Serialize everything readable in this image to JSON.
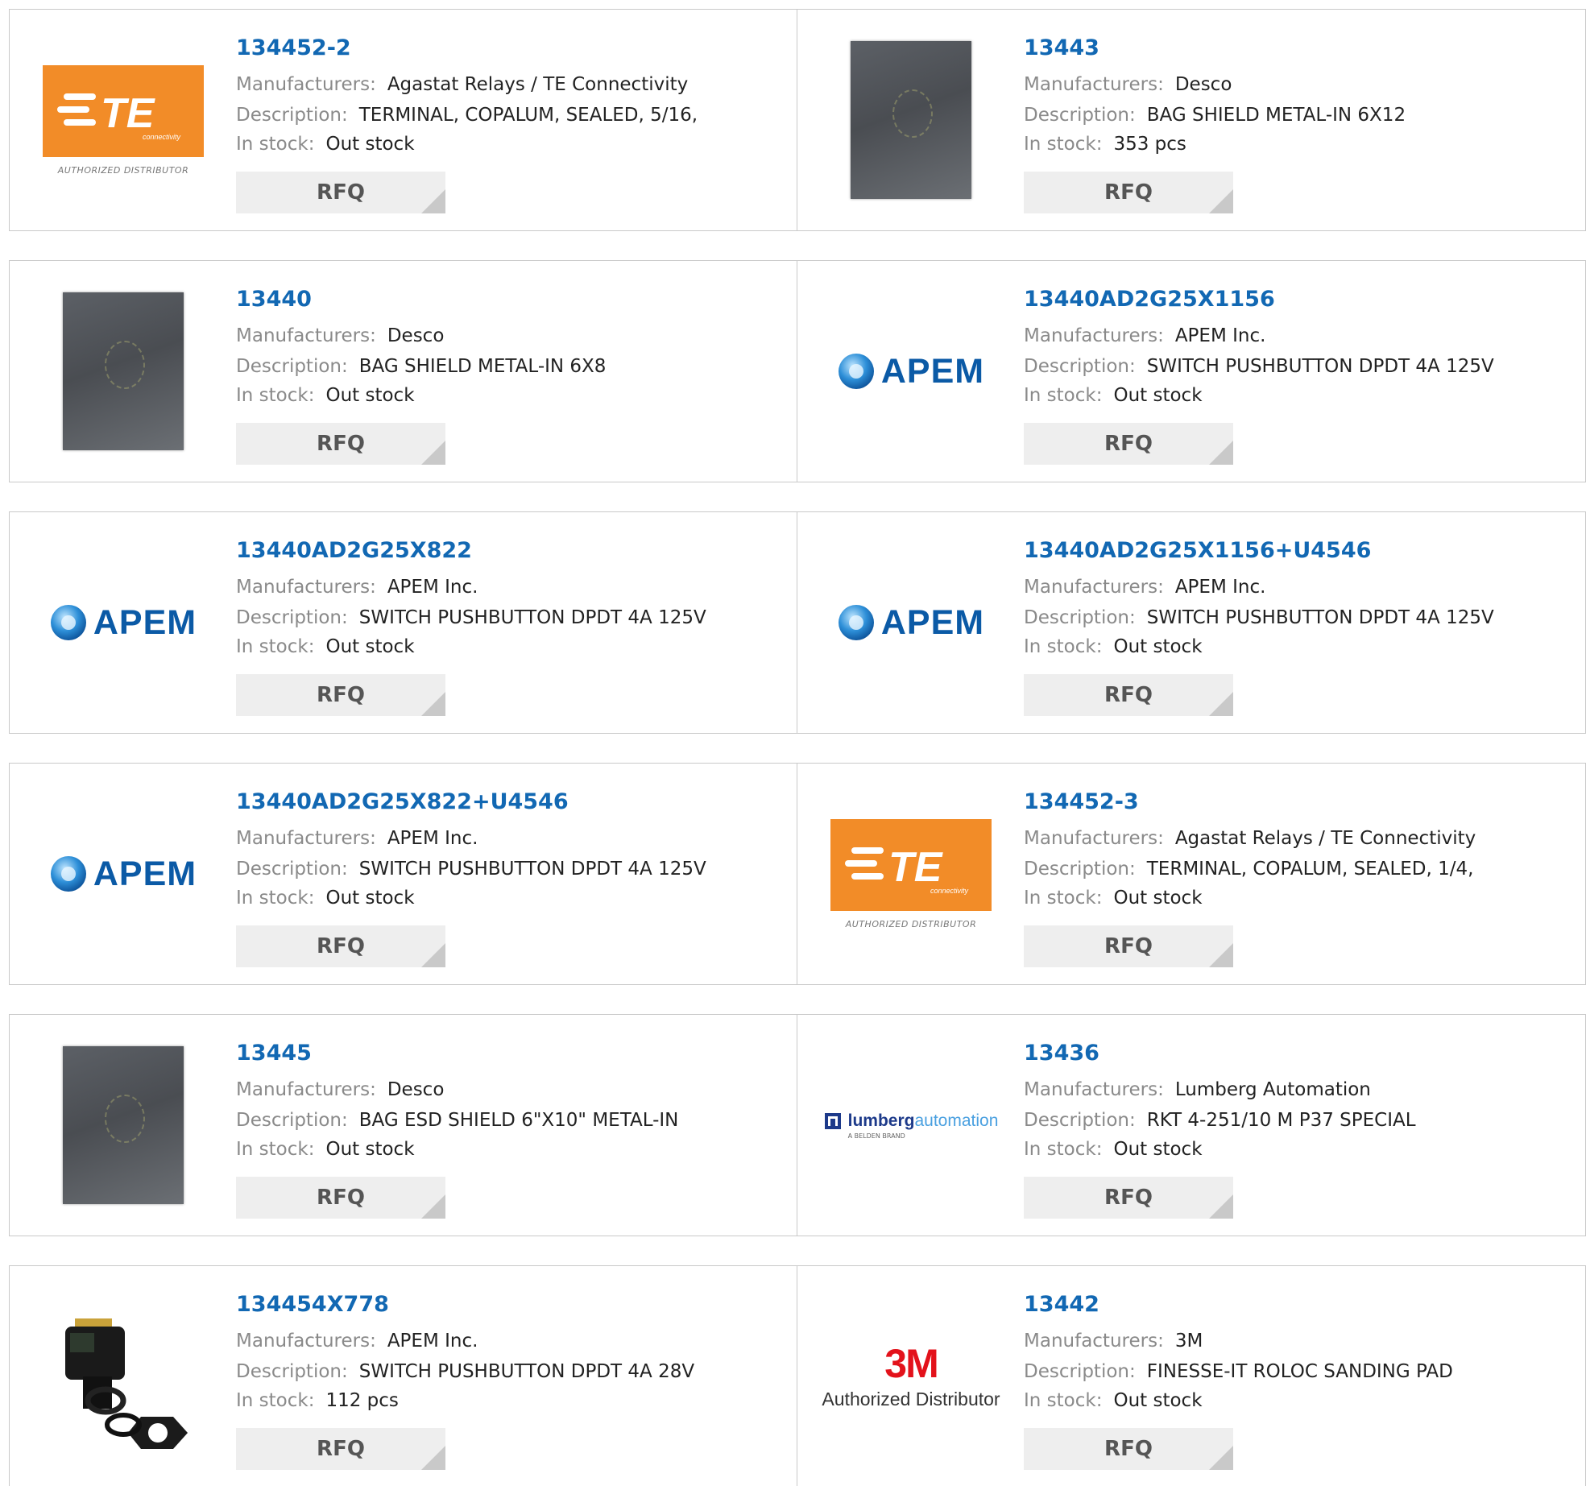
{
  "labels": {
    "manufacturers": "Manufacturers:",
    "description": "Description:",
    "in_stock": "In stock:",
    "rfq": "RFQ"
  },
  "brand_colors": {
    "te_orange": "#f28c28",
    "apem_blue": "#0b5aa6",
    "link_blue": "#1268b3",
    "three_m_red": "#e3121b"
  },
  "logo_text": {
    "te": "TE",
    "te_sub": "connectivity",
    "te_caption": "AUTHORIZED DISTRIBUTOR",
    "apem": "APEM",
    "lumberg_1": "lumberg",
    "lumberg_2": "automation",
    "lumberg_sub": "A BELDEN BRAND",
    "three_m": "3M",
    "three_m_caption": "Authorized Distributor"
  },
  "products": [
    {
      "part": "134452-2",
      "manufacturer": "Agastat Relays / TE Connectivity",
      "description": "TERMINAL, COPALUM, SEALED, 5/16,",
      "stock": "Out stock",
      "logo": "te"
    },
    {
      "part": "13443",
      "manufacturer": "Desco",
      "description": "BAG SHIELD METAL-IN 6X12",
      "stock": "353 pcs",
      "logo": "bag"
    },
    {
      "part": "13440",
      "manufacturer": "Desco",
      "description": "BAG SHIELD METAL-IN 6X8",
      "stock": "Out stock",
      "logo": "bag"
    },
    {
      "part": "13440AD2G25X1156",
      "manufacturer": "APEM Inc.",
      "description": "SWITCH PUSHBUTTON DPDT 4A 125V",
      "stock": "Out stock",
      "logo": "apem"
    },
    {
      "part": "13440AD2G25X822",
      "manufacturer": "APEM Inc.",
      "description": "SWITCH PUSHBUTTON DPDT 4A 125V",
      "stock": "Out stock",
      "logo": "apem"
    },
    {
      "part": "13440AD2G25X1156+U4546",
      "manufacturer": "APEM Inc.",
      "description": "SWITCH PUSHBUTTON DPDT 4A 125V",
      "stock": "Out stock",
      "logo": "apem"
    },
    {
      "part": "13440AD2G25X822+U4546",
      "manufacturer": "APEM Inc.",
      "description": "SWITCH PUSHBUTTON DPDT 4A 125V",
      "stock": "Out stock",
      "logo": "apem"
    },
    {
      "part": "134452-3",
      "manufacturer": "Agastat Relays / TE Connectivity",
      "description": "TERMINAL, COPALUM, SEALED, 1/4,",
      "stock": "Out stock",
      "logo": "te"
    },
    {
      "part": "13445",
      "manufacturer": "Desco",
      "description": "BAG ESD SHIELD 6\"X10\" METAL-IN",
      "stock": "Out stock",
      "logo": "bag"
    },
    {
      "part": "13436",
      "manufacturer": "Lumberg Automation",
      "description": "RKT 4-251/10 M P37 SPECIAL",
      "stock": "Out stock",
      "logo": "lumberg"
    },
    {
      "part": "134454X778",
      "manufacturer": "APEM Inc.",
      "description": "SWITCH PUSHBUTTON DPDT 4A 28V",
      "stock": "112 pcs",
      "logo": "switch"
    },
    {
      "part": "13442",
      "manufacturer": "3M",
      "description": "FINESSE-IT ROLOC SANDING PAD",
      "stock": "Out stock",
      "logo": "3m"
    }
  ]
}
